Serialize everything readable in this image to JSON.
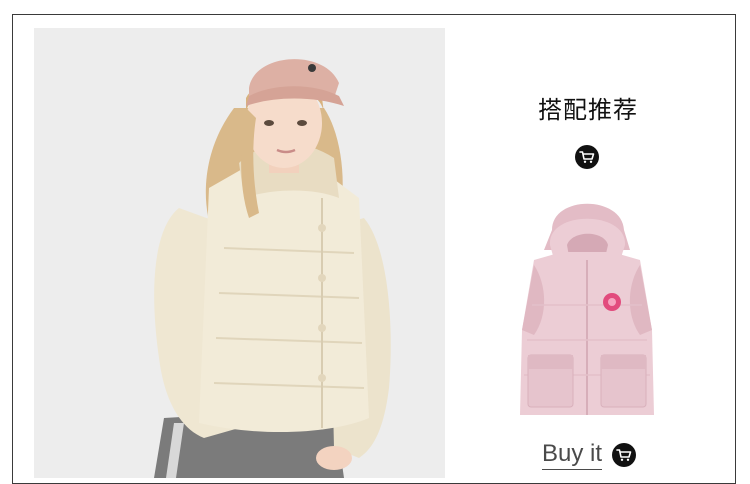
{
  "section": {
    "title": "搭配推荐"
  },
  "product": {
    "buy_label": "Buy it"
  },
  "icons": {
    "cart": "shopping-cart-icon"
  },
  "colors": {
    "frame": "#3a3a3a",
    "badge": "#111111",
    "vest": "#eccdd5",
    "cream_jacket": "#efe7d2"
  }
}
